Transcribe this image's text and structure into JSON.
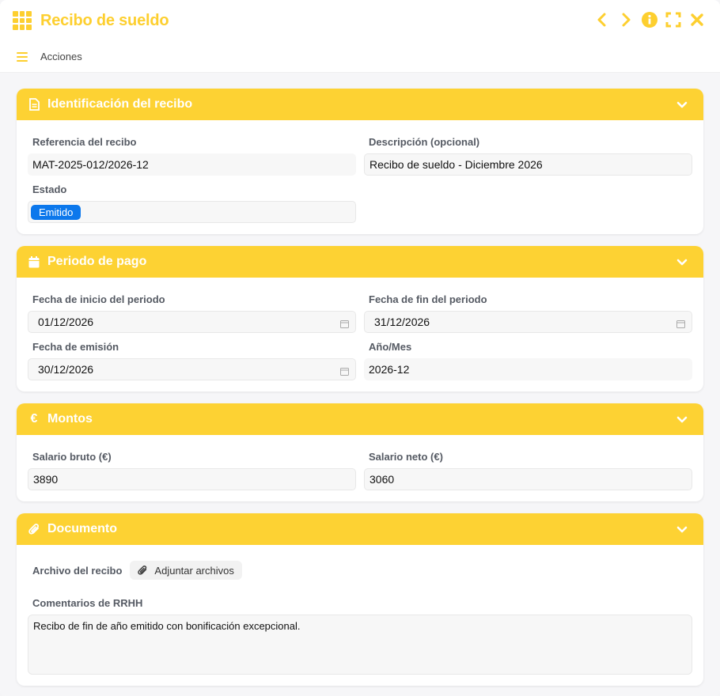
{
  "window": {
    "title": "Recibo de sueldo"
  },
  "actionbar": {
    "label": "Acciones"
  },
  "sections": {
    "identificacion": {
      "title": "Identificación del recibo",
      "referencia": {
        "label": "Referencia del recibo",
        "value": "MAT-2025-012/2026-12"
      },
      "descripcion": {
        "label": "Descripción (opcional)",
        "value": "Recibo de sueldo - Diciembre 2026"
      },
      "estado": {
        "label": "Estado",
        "value": "Emitido"
      }
    },
    "periodo": {
      "title": "Periodo de pago",
      "inicio": {
        "label": "Fecha de inicio del periodo",
        "value": "01/12/2026"
      },
      "fin": {
        "label": "Fecha de fin del periodo",
        "value": "31/12/2026"
      },
      "emision": {
        "label": "Fecha de emisión",
        "value": "30/12/2026"
      },
      "anio_mes": {
        "label": "Año/Mes",
        "value": "2026-12"
      }
    },
    "montos": {
      "title": "Montos",
      "icon_glyph": "€",
      "bruto": {
        "label": "Salario bruto (€)",
        "value": "3890"
      },
      "neto": {
        "label": "Salario neto (€)",
        "value": "3060"
      }
    },
    "documento": {
      "title": "Documento",
      "archivo_label": "Archivo del recibo",
      "adjuntar_label": "Adjuntar archivos",
      "comentarios": {
        "label": "Comentarios de RRHH",
        "value": "Recibo de fin de año emitido con bonificación excepcional."
      }
    }
  },
  "colors": {
    "accent": "#fdd233",
    "badge": "#0c78ec"
  },
  "icons": [
    "apps-grid-icon",
    "chevron-left-icon",
    "chevron-right-icon",
    "info-icon",
    "fullscreen-icon",
    "close-icon",
    "hamburger-icon",
    "document-icon",
    "calendar-icon",
    "euro-icon",
    "paperclip-icon",
    "chevron-down-icon"
  ]
}
